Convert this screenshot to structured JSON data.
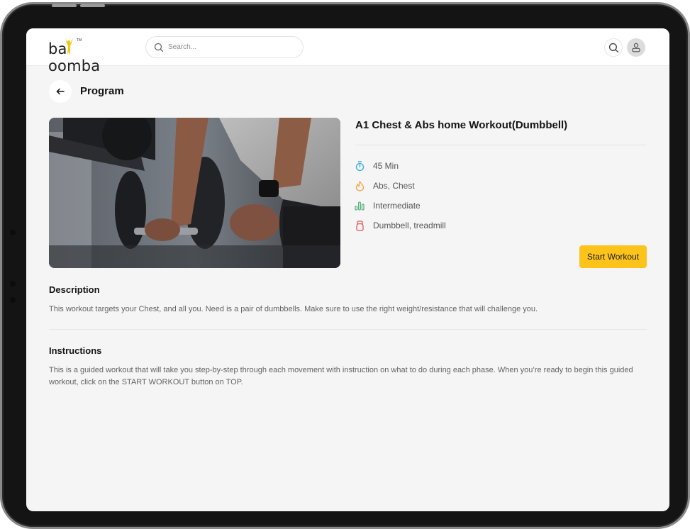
{
  "app": {
    "brand": "baoomba",
    "brand_tm": "TM",
    "colors": {
      "accent": "#fcc41b",
      "logo_yellow": "#f5c518",
      "timer_icon": "#3fb0d8",
      "flame_icon": "#f5a442",
      "level_icon": "#3fa66a",
      "equipment_icon": "#e05a5a"
    }
  },
  "header": {
    "search_placeholder": "Search...",
    "search_value": "",
    "icons": {
      "search": "search-icon",
      "profile": "user-icon"
    }
  },
  "page": {
    "back_icon": "arrow-left-icon",
    "title": "Program"
  },
  "program": {
    "image_alt": "Person lifting dumbbells from a gym rack",
    "title": "A1 Chest & Abs home Workout(Dumbbell)",
    "meta": [
      {
        "icon": "stopwatch-icon",
        "text": "45 Min"
      },
      {
        "icon": "flame-icon",
        "text": "Abs, Chest"
      },
      {
        "icon": "bar-chart-icon",
        "text": "Intermediate"
      },
      {
        "icon": "kettlebell-icon",
        "text": "Dumbbell, treadmill"
      }
    ],
    "start_button": "Start Workout"
  },
  "description": {
    "heading": "Description",
    "body": "This workout targets your Chest, and all you. Need is a pair of dumbbells. Make sure to use the right weight/resistance that will challenge you."
  },
  "instructions": {
    "heading": "Instructions",
    "body": "This is a guided workout that will take you step-by-step through each movement with instruction on what to do during each phase. When you’re ready to begin this guided workout, click on the START WORKOUT button on TOP."
  }
}
